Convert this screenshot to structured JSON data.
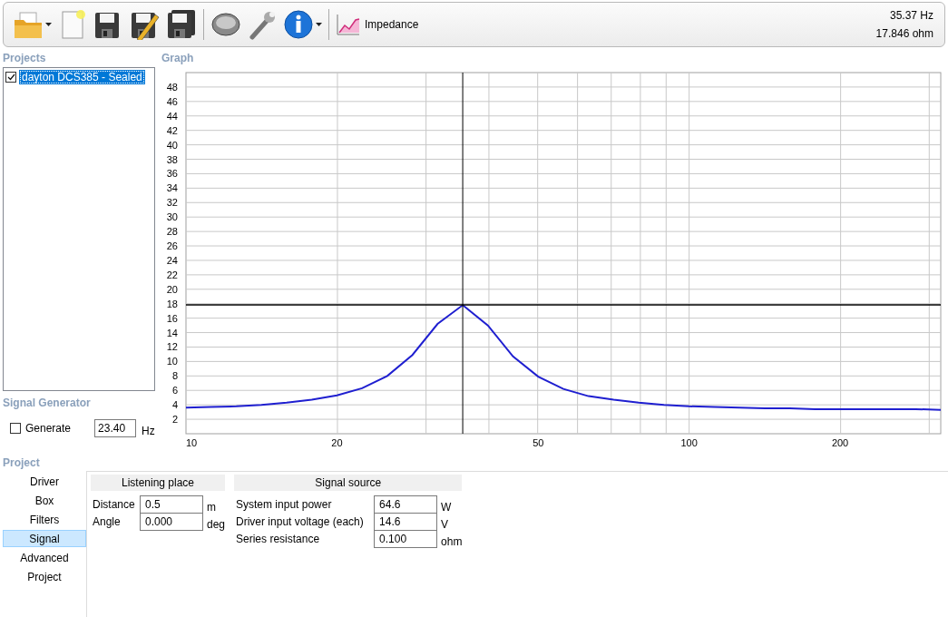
{
  "toolbar": {
    "buttons": [
      {
        "kind": "open",
        "dropdown": true
      },
      {
        "kind": "new",
        "dropdown": false
      },
      {
        "kind": "save",
        "dropdown": false
      },
      {
        "kind": "edit",
        "dropdown": false
      },
      {
        "kind": "saveas",
        "dropdown": false
      },
      {
        "kind": "speaker",
        "dropdown": false
      },
      {
        "kind": "wrench",
        "dropdown": false
      },
      {
        "kind": "info",
        "dropdown": true
      }
    ],
    "view_button": {
      "label": "Impedance"
    },
    "readout": [
      "35.37 Hz",
      "17.846 ohm"
    ]
  },
  "projects": {
    "title": "Projects",
    "items": [
      {
        "label": "dayton DCS385 - Sealed",
        "checked": true,
        "selected": true
      }
    ]
  },
  "signal_generator": {
    "title": "Signal Generator",
    "generate": {
      "label": "Generate",
      "checked": false
    },
    "frequency": {
      "value": "23.40",
      "unit": "Hz"
    }
  },
  "graph": {
    "title": "Graph",
    "chart_data": {
      "type": "line",
      "categories": [
        "10",
        null,
        null,
        null,
        null,
        null,
        "20",
        null,
        null,
        null,
        null,
        null,
        null,
        null,
        "50",
        null,
        null,
        null,
        null,
        null,
        "100",
        null,
        null,
        null,
        null,
        null,
        "200",
        null,
        null,
        null,
        null
      ],
      "series": [
        {
          "color": "#1f1fd0",
          "values": [
            3.6,
            3.7,
            3.8,
            4.0,
            4.3,
            4.7,
            5.3,
            6.3,
            8.0,
            10.9,
            15.2,
            17.8,
            15.0,
            10.7,
            7.9,
            6.2,
            5.2,
            4.7,
            4.3,
            4.0,
            3.8,
            3.7,
            3.6,
            3.5,
            3.5,
            3.4,
            3.4,
            3.4,
            3.4,
            3.4,
            3.3
          ]
        }
      ],
      "ylim": [
        0,
        50
      ],
      "yticks": [
        2,
        4,
        6,
        8,
        10,
        12,
        14,
        16,
        18,
        20,
        22,
        24,
        26,
        28,
        30,
        32,
        34,
        36,
        38,
        40,
        42,
        44,
        46,
        48
      ],
      "grid": true,
      "ref_lines": [
        {
          "axis": "y",
          "value": 17.846
        }
      ]
    }
  },
  "project": {
    "title": "Project",
    "nav": [
      {
        "label": "Driver",
        "selected": false
      },
      {
        "label": "Box",
        "selected": false
      },
      {
        "label": "Filters",
        "selected": false
      },
      {
        "label": "Signal",
        "selected": true
      },
      {
        "label": "Advanced",
        "selected": false
      },
      {
        "label": "Project",
        "selected": false
      }
    ],
    "groups": [
      {
        "title": "Listening place",
        "fields": [
          {
            "label": "Distance",
            "value": "0.5",
            "unit": "m"
          },
          {
            "label": "Angle",
            "value": "0.000",
            "unit": "deg"
          }
        ]
      },
      {
        "title": "Signal source",
        "fields": [
          {
            "label": "System input power",
            "value": "64.6",
            "unit": "W"
          },
          {
            "label": "Driver input voltage (each)",
            "value": "14.6",
            "unit": "V"
          },
          {
            "label": "Series resistance",
            "value": "0.100",
            "unit": "ohm"
          }
        ]
      }
    ]
  }
}
